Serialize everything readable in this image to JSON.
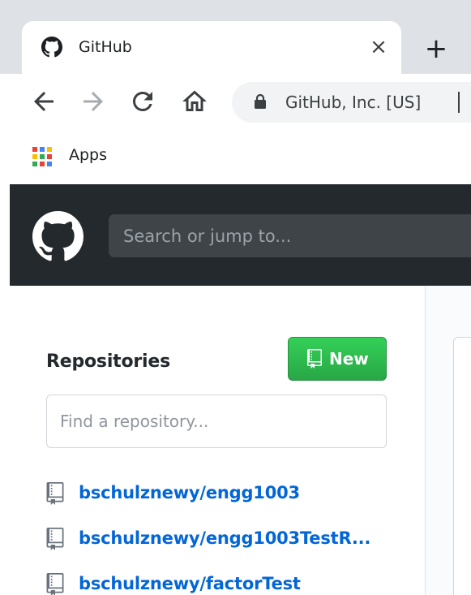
{
  "browser": {
    "tab": {
      "title": "GitHub",
      "favicon": "github-icon",
      "close_glyph": "×"
    },
    "new_tab_glyph": "+",
    "toolbar": {
      "back_icon": "back-arrow-icon",
      "forward_icon": "forward-arrow-icon",
      "reload_icon": "reload-icon",
      "home_icon": "home-icon",
      "site_identity": "GitHub, Inc. [US]",
      "lock_icon": "lock-icon"
    },
    "bookmarks": {
      "apps_label": "Apps",
      "apps_icon": "apps-grid-icon"
    }
  },
  "github": {
    "header": {
      "logo": "github-octocat-icon",
      "search_placeholder": "Search or jump to..."
    },
    "sidebar": {
      "heading": "Repositories",
      "new_button_label": "New",
      "new_button_icon": "repo-icon",
      "find_placeholder": "Find a repository...",
      "repos": [
        {
          "name": "bschulznewy/engg1003"
        },
        {
          "name": "bschulznewy/engg1003TestR..."
        },
        {
          "name": "bschulznewy/factorTest"
        }
      ]
    }
  },
  "colors": {
    "tabstrip_bg": "#dee1e6",
    "header_bg": "#24292e",
    "search_bg": "#3f4448",
    "new_button_green": "#2ea44f",
    "repo_link_blue": "#0366d6",
    "text_dark": "#24292e"
  }
}
